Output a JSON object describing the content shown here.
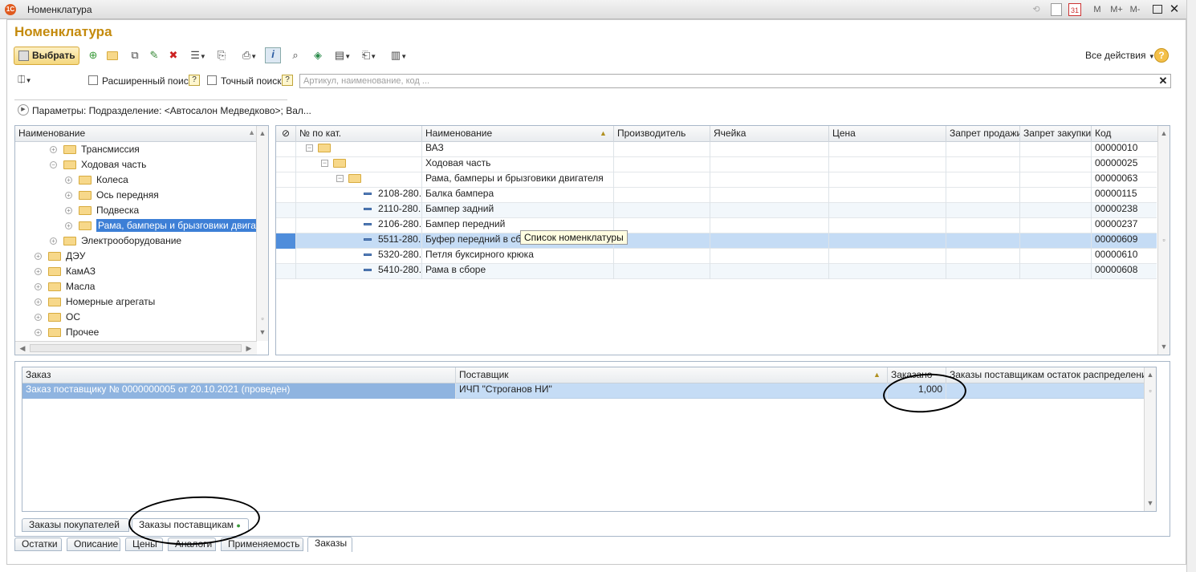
{
  "window": {
    "title": "Номенклатура",
    "app_icon": "1С",
    "controls": [
      "calendar-icon",
      "31",
      "M",
      "M+",
      "M-",
      "maximize-icon",
      "close-icon"
    ]
  },
  "form": {
    "title": "Номенклатура",
    "select_label": "Выбрать",
    "all_actions_label": "Все действия",
    "help_label": "?"
  },
  "search": {
    "extended_label": "Расширенный поиск",
    "exact_label": "Точный поиск",
    "hint_badge": "?",
    "placeholder": "Артикул, наименование, код ...",
    "params_text": "Параметры: Подразделение: <Автосалон Медведково>; Вал..."
  },
  "tree": {
    "header": "Наименование",
    "items": [
      {
        "label": "Трансмиссия",
        "level": 2,
        "state": "collapsed"
      },
      {
        "label": "Ходовая часть",
        "level": 2,
        "state": "expanded"
      },
      {
        "label": "Колеса",
        "level": 3,
        "state": "collapsed"
      },
      {
        "label": "Ось передняя",
        "level": 3,
        "state": "collapsed"
      },
      {
        "label": "Подвеска",
        "level": 3,
        "state": "collapsed"
      },
      {
        "label": "Рама, бамперы и брызговики двигателя",
        "level": 3,
        "state": "collapsed",
        "selected": true
      },
      {
        "label": "Электрооборудование",
        "level": 2,
        "state": "collapsed"
      },
      {
        "label": "ДЭУ",
        "level": 1,
        "state": "collapsed"
      },
      {
        "label": "КамАЗ",
        "level": 1,
        "state": "collapsed"
      },
      {
        "label": "Масла",
        "level": 1,
        "state": "collapsed"
      },
      {
        "label": "Номерные агрегаты",
        "level": 1,
        "state": "collapsed"
      },
      {
        "label": "ОС",
        "level": 1,
        "state": "collapsed"
      },
      {
        "label": "Прочее",
        "level": 1,
        "state": "collapsed"
      }
    ]
  },
  "grid": {
    "columns": [
      "",
      "№ по кат.",
      "Наименование",
      "Производитель",
      "Ячейка",
      "Цена",
      "Запрет продажи",
      "Запрет закупки",
      "Код"
    ],
    "rows": [
      {
        "type": "folder",
        "level": 0,
        "catalog": "",
        "name": "ВАЗ",
        "code": "00000010"
      },
      {
        "type": "folder",
        "level": 1,
        "catalog": "",
        "name": "Ходовая часть",
        "code": "00000025"
      },
      {
        "type": "folder",
        "level": 2,
        "catalog": "",
        "name": "Рама, бамперы и брызговики двигателя",
        "code": "00000063"
      },
      {
        "type": "item",
        "level": 3,
        "catalog": "2108-280...",
        "name": "Балка бампера",
        "code": "00000115"
      },
      {
        "type": "item",
        "level": 3,
        "catalog": "2110-280...",
        "name": "Бампер задний",
        "code": "00000238"
      },
      {
        "type": "item",
        "level": 3,
        "catalog": "2106-280...",
        "name": "Бампер передний",
        "code": "00000237"
      },
      {
        "type": "item",
        "level": 3,
        "catalog": "5511-280...",
        "name": "Буфер передний в сборе",
        "code": "00000609",
        "selected": true
      },
      {
        "type": "item",
        "level": 3,
        "catalog": "5320-280...",
        "name": "Петля буксирного крюка",
        "code": "00000610"
      },
      {
        "type": "item",
        "level": 3,
        "catalog": "5410-280...",
        "name": "Рама в сборе",
        "code": "00000608"
      }
    ],
    "tooltip": "Список номенклатуры"
  },
  "orders": {
    "columns": [
      "Заказ",
      "Поставщик",
      "Заказано",
      "Заказы поставщикам остаток распределения"
    ],
    "rows": [
      {
        "order": "Заказ поставщику № 0000000005  от 20.10.2021 (проведен)",
        "supplier": "ИЧП \"Строганов НИ\"",
        "qty": "1,000",
        "rest": ""
      }
    ]
  },
  "subtabs": [
    "Заказы покупателей",
    "Заказы поставщикам"
  ],
  "tabs": [
    "Остатки",
    "Описание",
    "Цены",
    "Аналоги",
    "Применяемость",
    "Заказы"
  ],
  "colors": {
    "accent": "#c48a0c",
    "selection": "#c5dcf5",
    "active_tab": "#ffffff"
  }
}
